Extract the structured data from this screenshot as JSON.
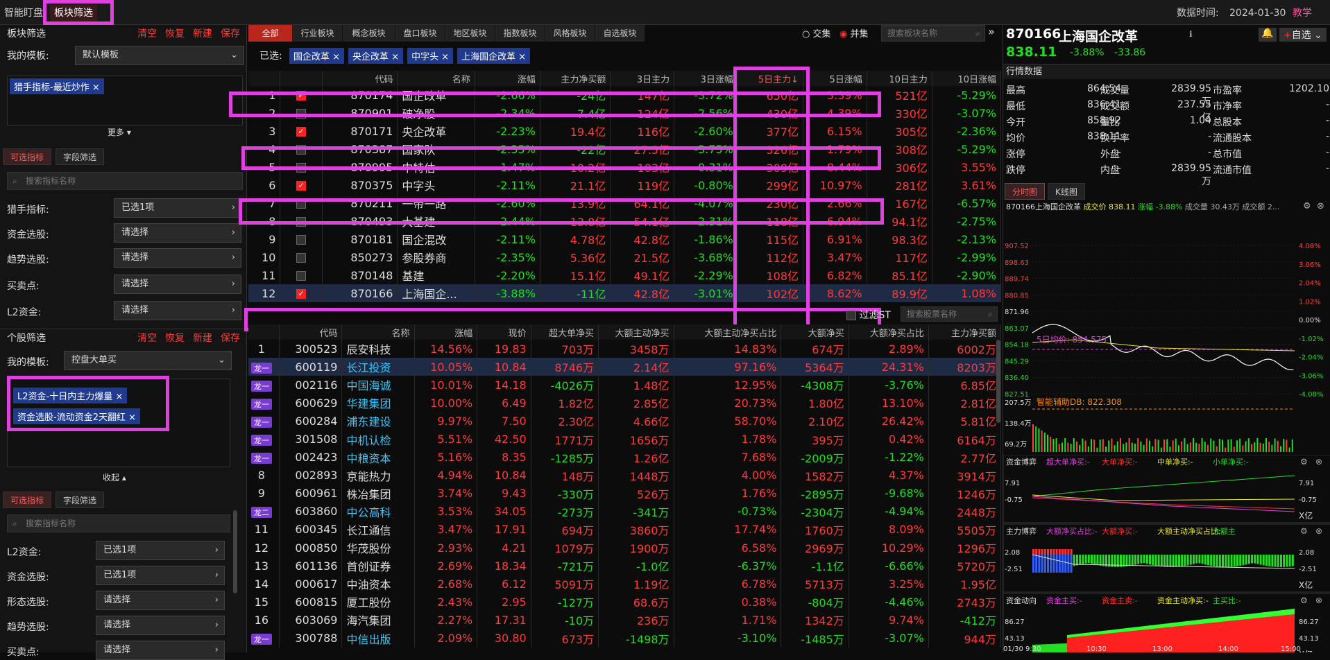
{
  "topbar": {
    "tab1": "智能盯盘",
    "tab2": "板块筛选",
    "date_label": "数据时间:",
    "date": "2024-01-30",
    "teach": "教学"
  },
  "left": {
    "sector_title": "板块筛选",
    "actions": [
      "清空",
      "恢复",
      "新建",
      "保存"
    ],
    "template_label": "我的模板:",
    "template_value": "默认模板",
    "tag1": "猎手指标-最近炒作",
    "more": "更多",
    "subtabs": [
      "可选指标",
      "字段筛选"
    ],
    "search_ph": "搜索指标名称",
    "filters": [
      {
        "label": "猎手指标:",
        "value": "已选1项"
      },
      {
        "label": "资金选股:",
        "value": "请选择"
      },
      {
        "label": "趋势选股:",
        "value": "请选择"
      },
      {
        "label": "买卖点:",
        "value": "请选择"
      },
      {
        "label": "L2资金:",
        "value": "请选择"
      }
    ],
    "stock_title": "个股筛选",
    "stock_template_value": "控盘大单买",
    "stock_tags": [
      "L2资金-十日内主力爆量",
      "资金选股-流动资金2天翻红"
    ],
    "collapse": "收起",
    "filters2": [
      {
        "label": "L2资金:",
        "value": "已选1项"
      },
      {
        "label": "资金选股:",
        "value": "已选1项"
      },
      {
        "label": "形态选股:",
        "value": "请选择"
      },
      {
        "label": "趋势选股:",
        "value": "请选择"
      },
      {
        "label": "买卖点:",
        "value": "请选择"
      }
    ]
  },
  "mid": {
    "tabs": [
      "全部",
      "行业板块",
      "概念板块",
      "盘口板块",
      "地区板块",
      "指数板块",
      "风格板块",
      "自选板块"
    ],
    "radio1": "交集",
    "radio2": "并集",
    "sector_search": "搜索板块名称",
    "selected_label": "已选:",
    "selected": [
      "国企改革",
      "央企改革",
      "中字头",
      "上海国企改革"
    ],
    "t1_headers": [
      "",
      "",
      "代码",
      "名称",
      "涨幅",
      "主力净买额",
      "3日主力",
      "3日涨幅",
      "5日主力↓",
      "5日涨幅",
      "10日主力",
      "10日涨幅"
    ],
    "t1_rows": [
      [
        "1",
        true,
        "870174",
        "国企改革",
        "-2.66%",
        "-24亿",
        "147亿",
        "-3.72%",
        "650亿",
        "3.39%",
        "521亿",
        "-5.29%"
      ],
      [
        "2",
        false,
        "870901",
        "破净股",
        "-2.34%",
        "-7.4亿",
        "124亿",
        "-2.56%",
        "430亿",
        "4.39%",
        "330亿",
        "-3.07%"
      ],
      [
        "3",
        true,
        "870171",
        "央企改革",
        "-2.23%",
        "19.4亿",
        "116亿",
        "-2.60%",
        "377亿",
        "6.15%",
        "305亿",
        "-2.36%"
      ],
      [
        "4",
        false,
        "870387",
        "国家队",
        "-2.35%",
        "-22亿",
        "27.5亿",
        "-3.75%",
        "326亿",
        "1.79%",
        "308亿",
        "-5.29%"
      ],
      [
        "5",
        false,
        "870995",
        "中特估",
        "-1.47%",
        "10.2亿",
        "103亿",
        "-0.31%",
        "309亿",
        "8.44%",
        "306亿",
        "3.55%"
      ],
      [
        "6",
        true,
        "870375",
        "中字头",
        "-2.11%",
        "21.1亿",
        "119亿",
        "-0.80%",
        "299亿",
        "10.97%",
        "281亿",
        "3.61%"
      ],
      [
        "7",
        false,
        "870211",
        "一带一路",
        "-2.60%",
        "13.9亿",
        "64.1亿",
        "-4.07%",
        "230亿",
        "2.66%",
        "167亿",
        "-6.57%"
      ],
      [
        "8",
        false,
        "870493",
        "大基建",
        "-2.44%",
        "13.8亿",
        "54.1亿",
        "-2.31%",
        "118亿",
        "6.94%",
        "94.1亿",
        "-2.75%"
      ],
      [
        "9",
        false,
        "870181",
        "国企混改",
        "-2.11%",
        "4.78亿",
        "42.8亿",
        "-1.86%",
        "115亿",
        "6.91%",
        "98.3亿",
        "-2.13%"
      ],
      [
        "10",
        false,
        "850273",
        "参股券商",
        "-2.35%",
        "5.36亿",
        "21.5亿",
        "-3.68%",
        "112亿",
        "3.47%",
        "117亿",
        "-2.99%"
      ],
      [
        "11",
        false,
        "870148",
        "基建",
        "-2.20%",
        "15.1亿",
        "49.1亿",
        "-2.29%",
        "108亿",
        "6.82%",
        "85.1亿",
        "-2.90%"
      ],
      [
        "12",
        true,
        "870166",
        "上海国企...",
        "-3.88%",
        "-11亿",
        "42.8亿",
        "-3.01%",
        "102亿",
        "8.62%",
        "89.9亿",
        "1.08%"
      ]
    ],
    "filter_st": "过滤ST",
    "stock_search": "搜索股票名称",
    "t2_headers": [
      "",
      "代码",
      "名称",
      "涨幅",
      "现价",
      "超大单净买",
      "大额主动净买",
      "大额主动净买占比",
      "大额净买",
      "大额净买占比",
      "主力净买额"
    ],
    "t2_rows": [
      [
        "1",
        "300523",
        "辰安科技",
        "14.56%",
        "19.83",
        "703万",
        "3458万",
        "14.83%",
        "674万",
        "2.89%",
        "6002万"
      ],
      [
        "龙一",
        "600119",
        "长江投资",
        "10.05%",
        "10.84",
        "8746万",
        "2.14亿",
        "97.16%",
        "5364万",
        "24.31%",
        "8203万"
      ],
      [
        "龙一",
        "002116",
        "中国海诚",
        "10.01%",
        "14.18",
        "-4026万",
        "1.48亿",
        "12.95%",
        "-4308万",
        "-3.76%",
        "6.85亿"
      ],
      [
        "龙一",
        "600629",
        "华建集团",
        "10.00%",
        "6.49",
        "1.82亿",
        "2.85亿",
        "20.73%",
        "1.80亿",
        "13.10%",
        "2.81亿"
      ],
      [
        "龙一",
        "600284",
        "浦东建设",
        "9.97%",
        "7.50",
        "2.30亿",
        "4.66亿",
        "58.70%",
        "2.10亿",
        "26.42%",
        "5.81亿"
      ],
      [
        "龙一",
        "301508",
        "中机认检",
        "5.51%",
        "42.50",
        "1771万",
        "1656万",
        "1.78%",
        "395万",
        "0.42%",
        "6164万"
      ],
      [
        "龙一",
        "002423",
        "中粮资本",
        "5.16%",
        "8.35",
        "-1285万",
        "1.26亿",
        "7.68%",
        "-2009万",
        "-1.22%",
        "2.77亿"
      ],
      [
        "8",
        "002893",
        "京能热力",
        "4.94%",
        "10.84",
        "148万",
        "1448万",
        "4.00%",
        "1582万",
        "4.37%",
        "3914万"
      ],
      [
        "9",
        "600961",
        "株冶集团",
        "3.74%",
        "9.43",
        "-330万",
        "526万",
        "1.76%",
        "-2895万",
        "-9.68%",
        "1246万"
      ],
      [
        "龙二",
        "603860",
        "中公高科",
        "3.53%",
        "34.05",
        "-273万",
        "-341万",
        "-0.73%",
        "-2304万",
        "-4.94%",
        "2448万"
      ],
      [
        "11",
        "600345",
        "长江通信",
        "3.47%",
        "17.91",
        "694万",
        "3860万",
        "17.74%",
        "1760万",
        "8.09%",
        "5505万"
      ],
      [
        "12",
        "000850",
        "华茂股份",
        "2.93%",
        "4.21",
        "1079万",
        "1900万",
        "6.58%",
        "2969万",
        "10.29%",
        "1296万"
      ],
      [
        "13",
        "601136",
        "首创证券",
        "2.69%",
        "18.34",
        "-721万",
        "-1.0亿",
        "-6.37%",
        "-1.1亿",
        "-6.66%",
        "5720万"
      ],
      [
        "14",
        "000617",
        "中油资本",
        "2.68%",
        "6.12",
        "5091万",
        "1.19亿",
        "6.78%",
        "5713万",
        "3.25%",
        "1.95亿"
      ],
      [
        "15",
        "600815",
        "厦工股份",
        "2.43%",
        "2.95",
        "-127万",
        "68.6万",
        "0.38%",
        "-804万",
        "-4.46%",
        "2743万"
      ],
      [
        "16",
        "603069",
        "海汽集团",
        "2.27%",
        "17.31",
        "-10万",
        "236万",
        "1.71%",
        "1342万",
        "9.74%",
        "-412万"
      ],
      [
        "龙一",
        "300788",
        "中信出版",
        "2.09%",
        "30.80",
        "673万",
        "-1498万",
        "-3.10%",
        "-1485万",
        "-3.07%",
        "944万"
      ]
    ]
  },
  "right": {
    "code": "870166",
    "name": "上海国企改革",
    "add": "自选",
    "price": "838.11",
    "pct": "-3.88%",
    "chg": "-33.86",
    "quote_title": "行情数据",
    "q": [
      [
        "最高",
        "864.54",
        "成交量",
        "2839.95万",
        "市盈率",
        "1202.10"
      ],
      [
        "最低",
        "836.41",
        "成交额",
        "237.55亿",
        "市净率",
        "-"
      ],
      [
        "今开",
        "858.92",
        "量比",
        "1.04",
        "总股本",
        "-"
      ],
      [
        "均价",
        "838.11",
        "换手率",
        "-",
        "流通股本",
        "-"
      ],
      [
        "涨停",
        "-",
        "外盘",
        "-",
        "总市值",
        "-"
      ],
      [
        "跌停",
        "-",
        "内盘",
        "2839.95万",
        "流通市值",
        "-"
      ]
    ],
    "ctabs": [
      "分时图",
      "K线图"
    ],
    "chart_title": "870166上海国企改革",
    "chart_price_label": "成交价 838.11",
    "chart_pct": "涨幅 -3.88%",
    "chart_vol": "成交量 30.43万",
    "chart_amt": "成交额 2...",
    "yl": [
      "907.52",
      "898.63",
      "889.74",
      "880.85",
      "871.96",
      "863.07",
      "854.18",
      "845.29",
      "836.40",
      "827.51"
    ],
    "yr": [
      "4.08%",
      "3.06%",
      "2.04%",
      "1.02%",
      "0.00%",
      "-1.02%",
      "-2.04%",
      "-3.06%",
      "-4.08%"
    ],
    "ma5": "5日均价: 854.575",
    "vol_l": [
      "207.5万",
      "138.4万",
      "69.2万"
    ],
    "aux": "智能辅助DB: 822.308",
    "p1_title": "资金博弈",
    "p1_legend": [
      "超大单净买:-",
      "大单净买:-",
      "中单净买:-",
      "小单净买:-"
    ],
    "p1_y": [
      "7.91",
      "-0.75"
    ],
    "unit": "X亿",
    "p2_title": "主力博弈",
    "p2_legend": [
      "大额净买占比:-",
      "大额净买:-",
      "大额主动净买占比:-",
      "大额主"
    ],
    "p2_y": [
      "2.08",
      "-2.51"
    ],
    "p3_title": "资金动向",
    "p3_legend": [
      "资金主买:-",
      "资金主卖:-",
      "资金主动净买:-",
      "主买比:-"
    ],
    "p3_y": [
      "86.27",
      "43.13"
    ],
    "times": [
      "01/30 9:30",
      "10:30",
      "13:00",
      "14:00",
      "15:00"
    ]
  }
}
